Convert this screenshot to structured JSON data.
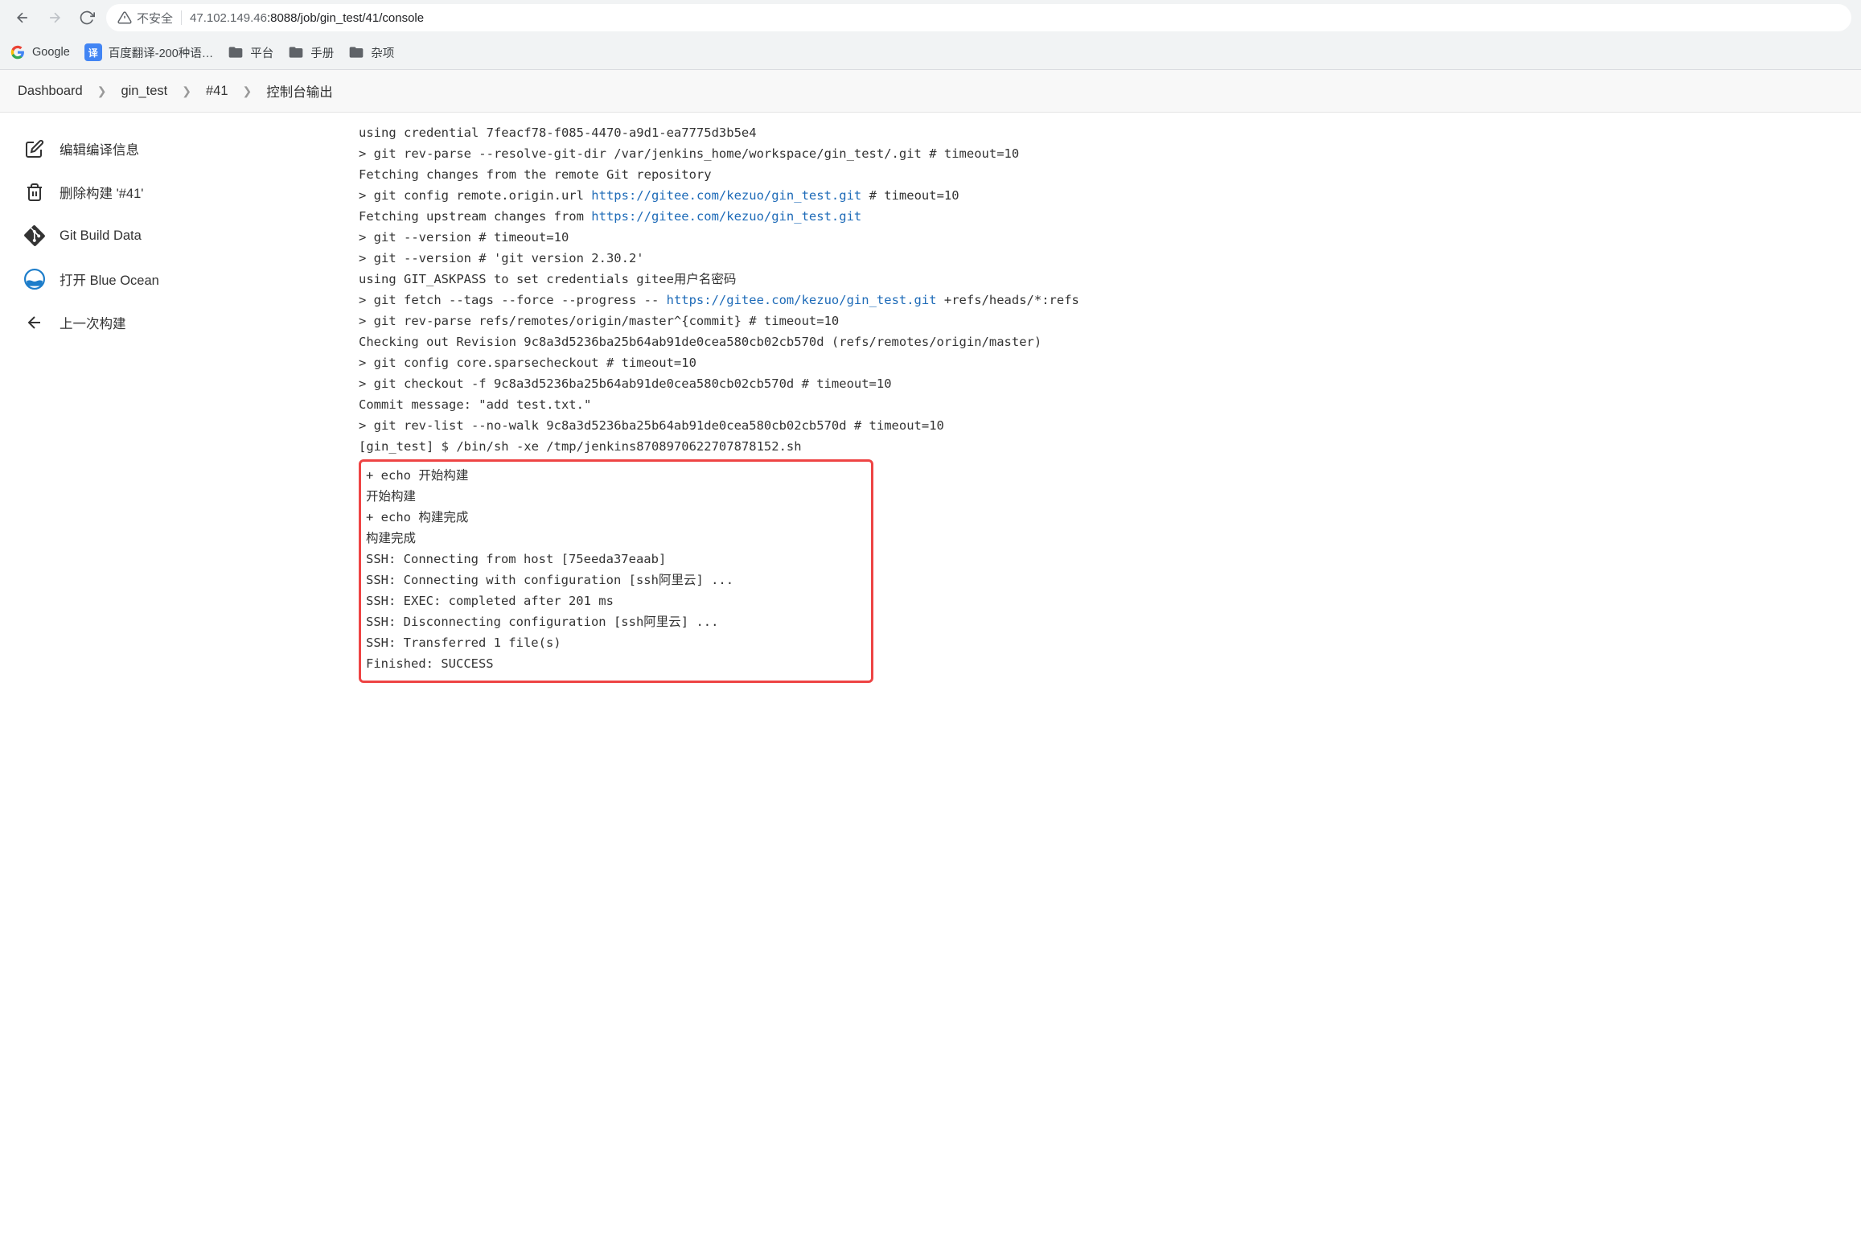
{
  "browser": {
    "insecure_label": "不安全",
    "url_host": "47.102.149.46",
    "url_rest": ":8088/job/gin_test/41/console"
  },
  "bookmarks": {
    "google": "Google",
    "translate": "百度翻译-200种语…",
    "translate_badge": "译",
    "platform": "平台",
    "manual": "手册",
    "misc": "杂项"
  },
  "breadcrumb": {
    "dashboard": "Dashboard",
    "job": "gin_test",
    "build": "#41",
    "page": "控制台输出"
  },
  "sidebar": {
    "edit_build": "编辑编译信息",
    "delete_build": "删除构建 '#41'",
    "git_data": "Git Build Data",
    "blue_ocean": "打开 Blue Ocean",
    "prev_build": "上一次构建"
  },
  "console": {
    "l01": "using credential 7feacf78-f085-4470-a9d1-ea7775d3b5e4",
    "l02": " > git rev-parse --resolve-git-dir /var/jenkins_home/workspace/gin_test/.git # timeout=10",
    "l03": "Fetching changes from the remote Git repository",
    "l04a": " > git config remote.origin.url ",
    "l04_link": "https://gitee.com/kezuo/gin_test.git",
    "l04b": " # timeout=10",
    "l05a": "Fetching upstream changes from ",
    "l05_link": "https://gitee.com/kezuo/gin_test.git",
    "l06": " > git --version # timeout=10",
    "l07": " > git --version # 'git version 2.30.2'",
    "l08": "using GIT_ASKPASS to set credentials gitee用户名密码",
    "l09a": " > git fetch --tags --force --progress -- ",
    "l09_link": "https://gitee.com/kezuo/gin_test.git",
    "l09b": " +refs/heads/*:refs",
    "l10": " > git rev-parse refs/remotes/origin/master^{commit} # timeout=10",
    "l11": "Checking out Revision 9c8a3d5236ba25b64ab91de0cea580cb02cb570d (refs/remotes/origin/master)",
    "l12": " > git config core.sparsecheckout # timeout=10",
    "l13": " > git checkout -f 9c8a3d5236ba25b64ab91de0cea580cb02cb570d # timeout=10",
    "l14": "Commit message: \"add test.txt.\"",
    "l15": " > git rev-list --no-walk 9c8a3d5236ba25b64ab91de0cea580cb02cb570d # timeout=10",
    "l16": "[gin_test] $ /bin/sh -xe /tmp/jenkins8708970622707878152.sh",
    "h01": "+ echo 开始构建",
    "h02": "开始构建",
    "h03": "+ echo 构建完成",
    "h04": "构建完成",
    "h05": "SSH: Connecting from host [75eeda37eaab]",
    "h06": "SSH: Connecting with configuration [ssh阿里云] ...",
    "h07": "SSH: EXEC: completed after 201 ms",
    "h08": "SSH: Disconnecting configuration [ssh阿里云] ...",
    "h09": "SSH: Transferred 1 file(s)",
    "h10": "Finished: SUCCESS"
  }
}
